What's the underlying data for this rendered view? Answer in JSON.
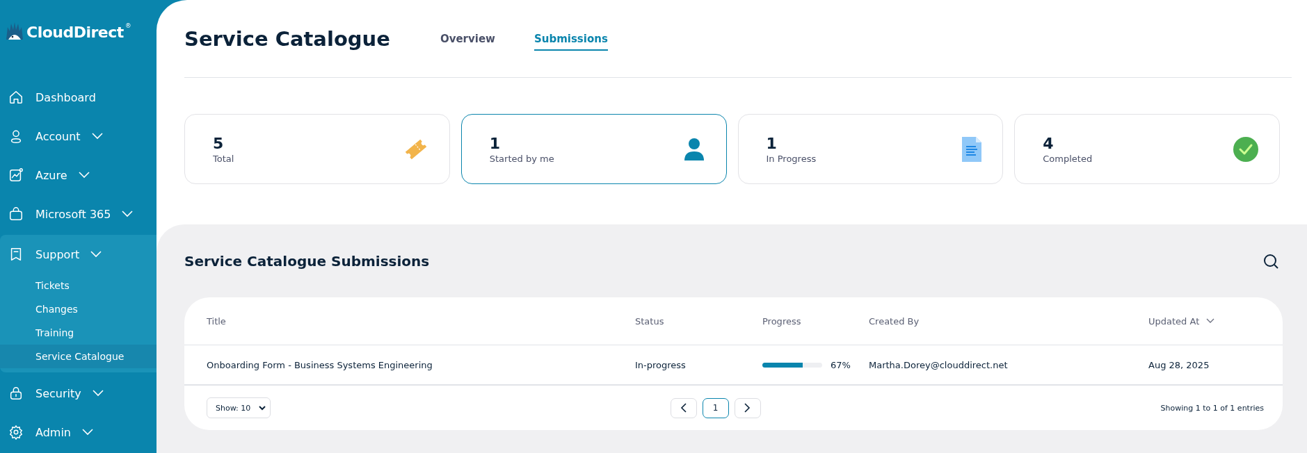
{
  "logo": {
    "name": "CloudDirect",
    "mark": "®"
  },
  "sidebar": {
    "items": [
      {
        "label": "Dashboard"
      },
      {
        "label": "Account",
        "expanded": false
      },
      {
        "label": "Azure",
        "expanded": false
      },
      {
        "label": "Microsoft 365",
        "expanded": false
      },
      {
        "label": "Support",
        "expanded": true,
        "children": [
          {
            "label": "Tickets",
            "selected": false
          },
          {
            "label": "Changes",
            "selected": false
          },
          {
            "label": "Training",
            "selected": false
          },
          {
            "label": "Service Catalogue",
            "selected": true
          }
        ]
      },
      {
        "label": "Security",
        "expanded": false
      },
      {
        "label": "Admin",
        "expanded": false
      }
    ]
  },
  "page": {
    "title": "Service Catalogue"
  },
  "tabs": [
    {
      "label": "Overview",
      "selected": false
    },
    {
      "label": "Submissions",
      "selected": true
    }
  ],
  "stats": [
    {
      "value": "5",
      "label": "Total",
      "selected": false
    },
    {
      "value": "1",
      "label": "Started by me",
      "selected": true
    },
    {
      "value": "1",
      "label": "In Progress",
      "selected": false
    },
    {
      "value": "4",
      "label": "Completed",
      "selected": false
    }
  ],
  "submissions": {
    "title": "Service Catalogue Submissions",
    "table": {
      "columns": [
        {
          "label": "Title",
          "sorted": false
        },
        {
          "label": "Status",
          "sorted": false
        },
        {
          "label": "Progress",
          "sorted": false
        },
        {
          "label": "Created By",
          "sorted": false
        },
        {
          "label": "Updated At",
          "sorted": true
        }
      ],
      "rows": [
        {
          "title": "Onboarding Form - Business Systems Engineering",
          "status": "In-progress",
          "level": 0.67,
          "reading": "67%",
          "created_by": "Martha.Dorey@clouddirect.net",
          "updated_at": "Aug 28, 2025"
        }
      ]
    },
    "page_size": "Show: 10",
    "pages": [
      {
        "label": "1",
        "selected": true
      }
    ],
    "summary": "Showing 1 to 1 of 1 entries"
  }
}
